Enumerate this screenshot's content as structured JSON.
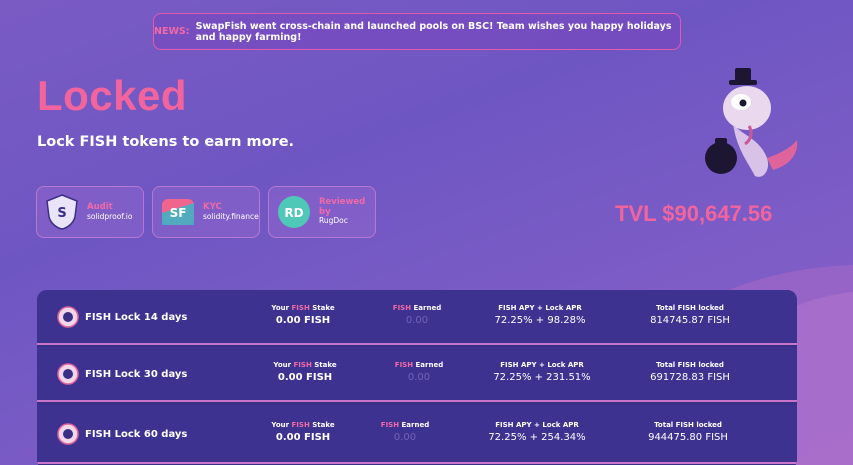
{
  "news": {
    "tag": "NEWS:",
    "message": "SwapFish went cross-chain and launched pools on BSC! Team wishes you happy holidays and happy farming!"
  },
  "hero": {
    "title": "Locked",
    "subtitle": "Lock FISH tokens to earn more.",
    "tvl": "TVL $90,647.56"
  },
  "badges": [
    {
      "title": "Audit",
      "subtitle": "solidproof.io",
      "icon": "shield-icon"
    },
    {
      "title": "KYC",
      "subtitle": "solidity.finance",
      "icon": "sf-logo-icon"
    },
    {
      "title": "Reviewed by",
      "subtitle": "RugDoc",
      "icon": "rugdoc-logo-icon"
    }
  ],
  "labels": {
    "stake_prefix": "Your ",
    "stake_token": "FISH",
    "stake_suffix": " Stake",
    "earned_token": "FISH",
    "earned_suffix": " Earned",
    "apy": "FISH APY + Lock APR",
    "total": "Total FISH locked"
  },
  "pools": [
    {
      "name": "FISH Lock 14 days",
      "stake": "0.00 FISH",
      "earned": "0.00",
      "apy": "72.25% + 98.28%",
      "total": "814745.87 FISH"
    },
    {
      "name": "FISH Lock 30 days",
      "stake": "0.00 FISH",
      "earned": "0.00",
      "apy": "72.25% + 231.51%",
      "total": "691728.83 FISH"
    },
    {
      "name": "FISH Lock 60 days",
      "stake": "0.00 FISH",
      "earned": "0.00",
      "apy": "72.25% + 254.34%",
      "total": "944475.80 FISH"
    }
  ],
  "colors": {
    "accent": "#f2649e",
    "row_bg": "#3e3290",
    "divider": "#c874c8"
  }
}
